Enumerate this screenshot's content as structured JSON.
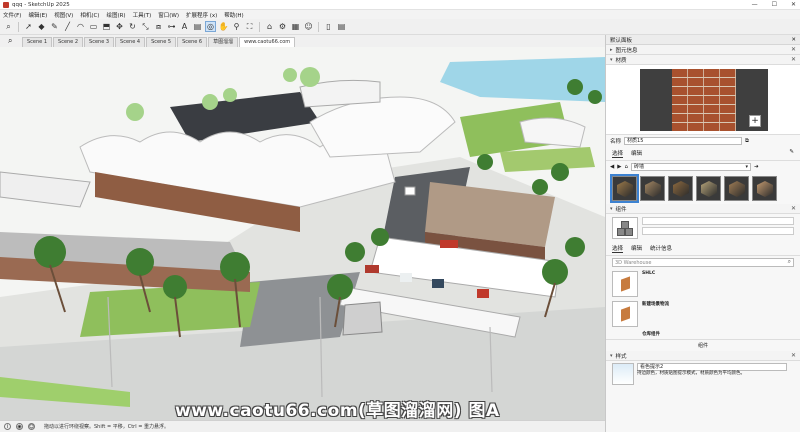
{
  "window": {
    "title": "qqq - SketchUp 2025",
    "controls": [
      "—",
      "☐",
      "✕"
    ]
  },
  "menu": [
    "文件(F)",
    "编辑(E)",
    "视图(V)",
    "相机(C)",
    "绘图(R)",
    "工具(T)",
    "窗口(W)",
    "扩展程序 (x)",
    "帮助(H)"
  ],
  "toolbar_icons": [
    "search-icon",
    "select-icon",
    "eraser-icon",
    "pencil-icon",
    "line-icon",
    "arc-icon",
    "rectangle-icon",
    "push-pull-icon",
    "move-icon",
    "rotate-icon",
    "scale-icon",
    "offset-icon",
    "tape-icon",
    "text-icon",
    "paint-icon",
    "orbit-icon",
    "pan-icon",
    "zoom-icon",
    "zoom-extents-icon",
    "warehouse-icon",
    "extension-icon",
    "layout-icon",
    "user-icon",
    "new-icon",
    "document-icon"
  ],
  "scenes": {
    "tabs": [
      "Scene 1",
      "Scene 2",
      "Scene 3",
      "Scene 4",
      "Scene 5",
      "Scene 6",
      "草图溜溜",
      "www.caotu66.com"
    ],
    "active_index": 7
  },
  "status": {
    "message": "拖动以进行环绕视察。Shift = 平移，Ctrl = 重力悬浮。"
  },
  "watermark": "www.caotu66.com(草图溜溜网) 图A",
  "tray": {
    "title": "默认面板",
    "entity_info": "图元信息",
    "materials": {
      "header": "材质",
      "name_label": "名称",
      "name_value": "材质15",
      "tabs": [
        "选择",
        "编辑"
      ],
      "library": "砖墙",
      "swatch_colors": [
        "#9c7a4a",
        "#a58864",
        "#8d6a3f",
        "#b6a47a",
        "#a07d55",
        "#c49a70"
      ]
    },
    "components": {
      "header": "组件",
      "tabs": [
        "选择",
        "编辑",
        "统计信息"
      ],
      "search_placeholder": "3D Warehouse",
      "items": [
        {
          "name": "SHLC"
        },
        {
          "name": "新建场景物流"
        },
        {
          "name": "仓库组件"
        }
      ],
      "footer": "组件"
    },
    "styles": {
      "header": "样式",
      "name": "看色提示2",
      "description": "持边颜色，材质贴图提示模式，材质颜色为平均颜色。"
    }
  },
  "colors": {
    "accent": "#3d82d1",
    "brick": "#a8512e",
    "water": "#9fd6e8"
  }
}
